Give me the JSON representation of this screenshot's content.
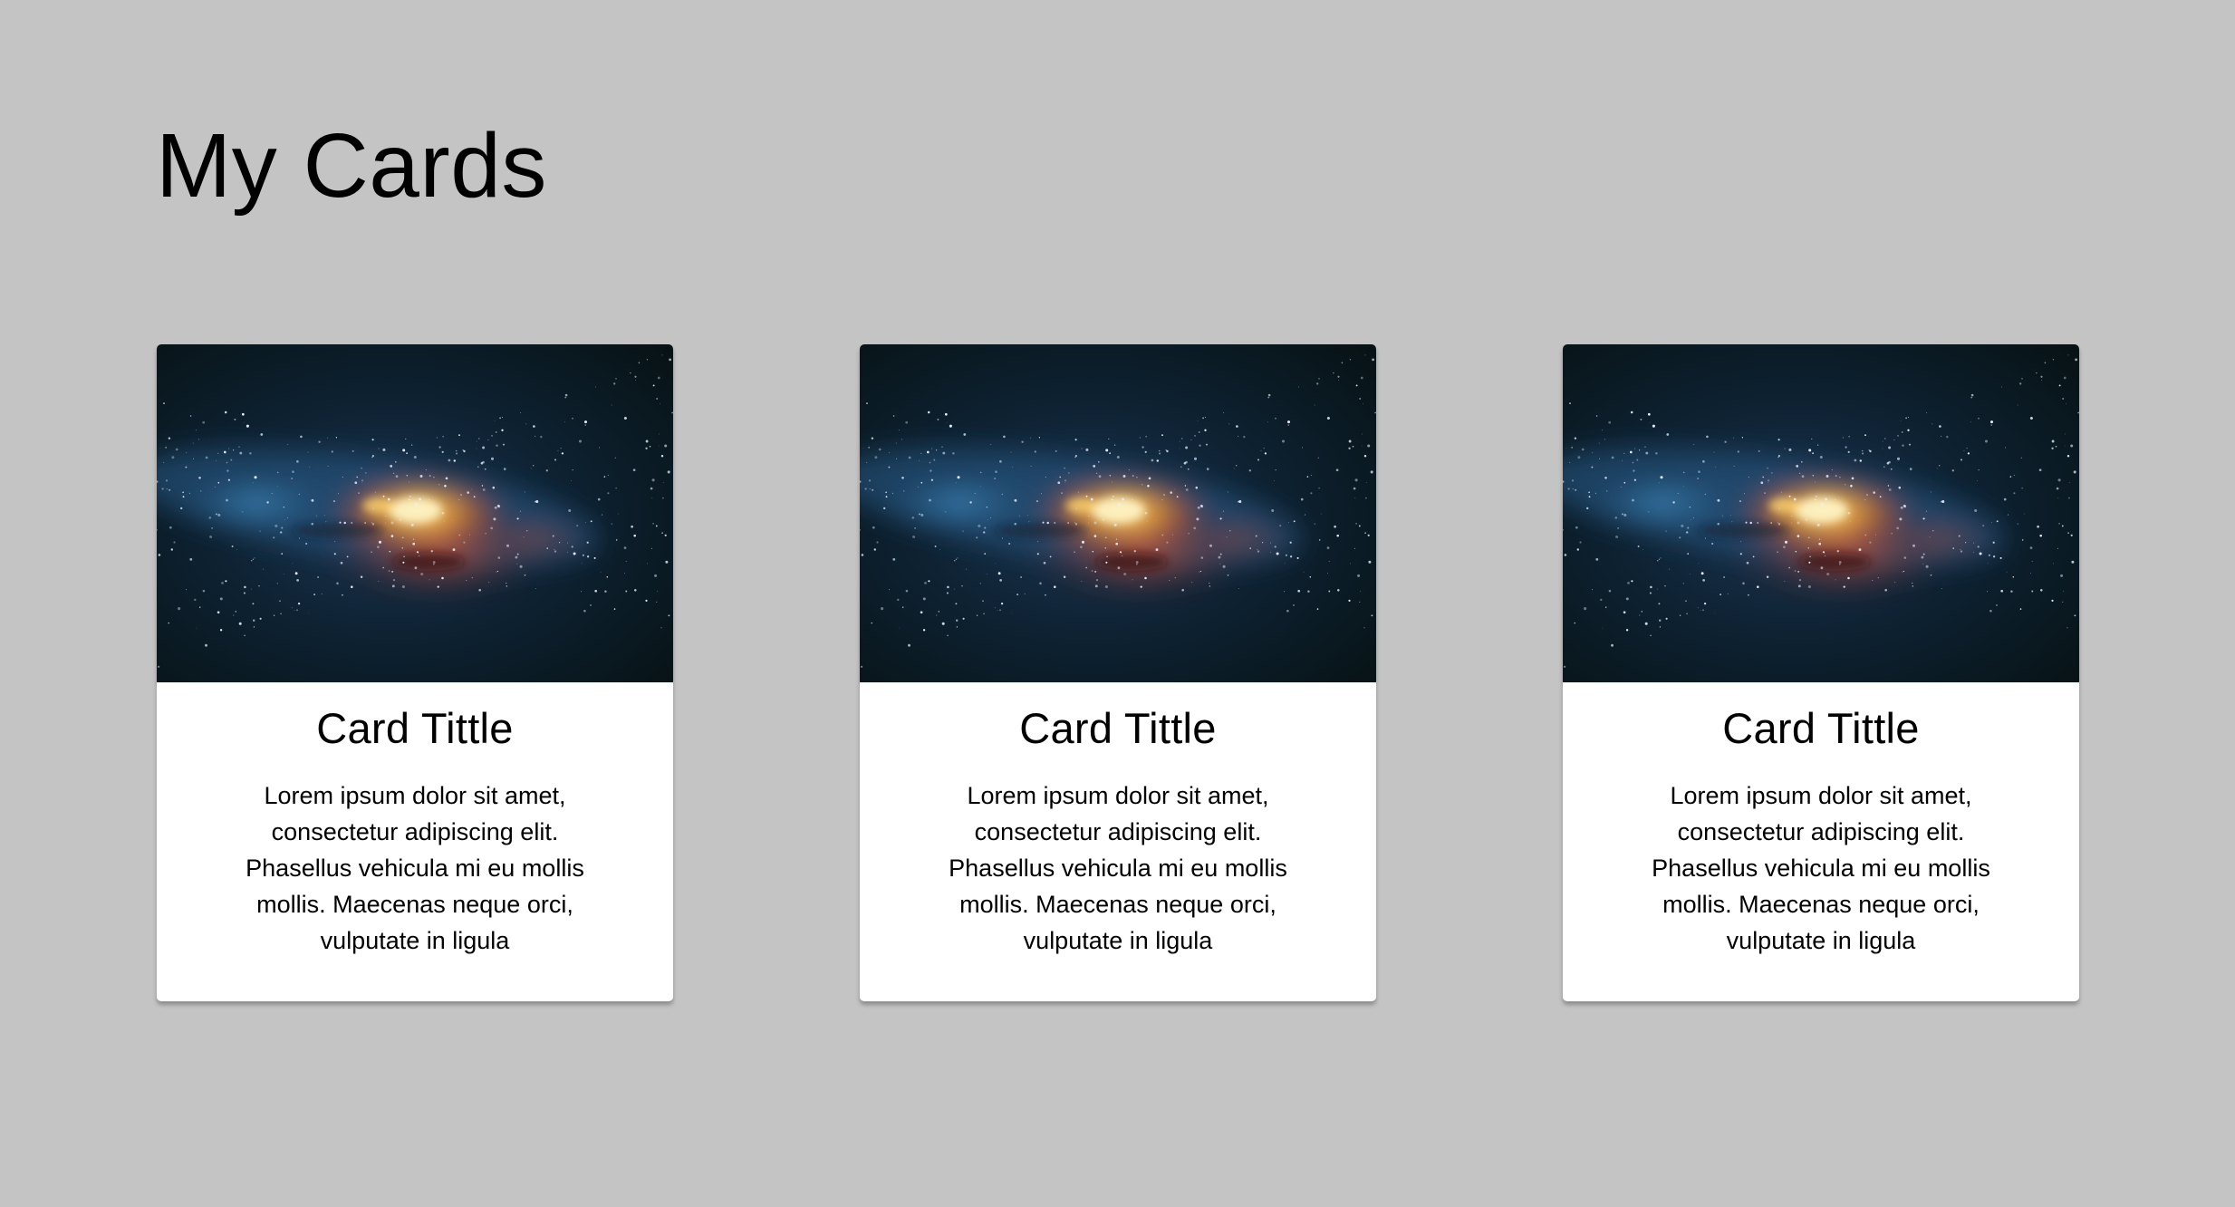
{
  "page": {
    "title": "My Cards",
    "background": "#c4c4c4"
  },
  "cards": [
    {
      "image": "galaxy-image",
      "title": "Card Tittle",
      "text": "Lorem ipsum dolor sit amet, consectetur adipiscing elit. Phasellus vehicula mi eu mollis mollis. Maecenas neque orci, vulputate in ligula"
    },
    {
      "image": "galaxy-image",
      "title": "Card Tittle",
      "text": "Lorem ipsum dolor sit amet, consectetur adipiscing elit. Phasellus vehicula mi eu mollis mollis. Maecenas neque orci, vulputate in ligula"
    },
    {
      "image": "galaxy-image",
      "title": "Card Tittle",
      "text": "Lorem ipsum dolor sit amet, consectetur adipiscing elit. Phasellus vehicula mi eu mollis mollis. Maecenas neque orci, vulputate in ligula"
    }
  ]
}
